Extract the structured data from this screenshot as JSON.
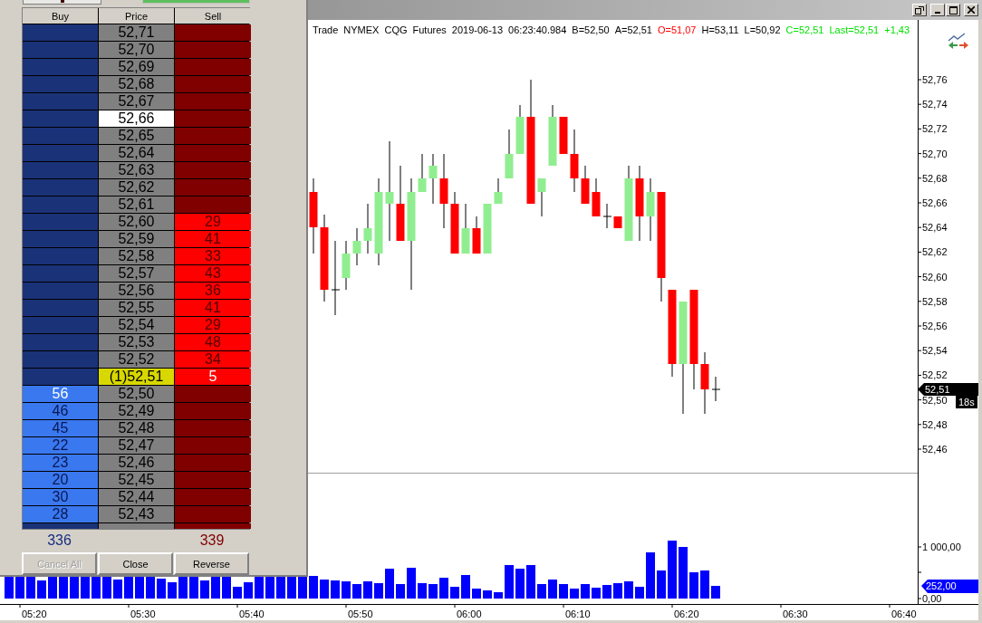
{
  "dom_panel": {
    "columns": [
      "Buy",
      "Price",
      "Sell"
    ],
    "rows": [
      {
        "kind": "level",
        "price": "52,71",
        "last_trade": false,
        "has_position": false
      },
      {
        "kind": "level",
        "price": "52,70",
        "last_trade": false,
        "has_position": false
      },
      {
        "kind": "level",
        "price": "52,69",
        "last_trade": false,
        "has_position": false
      },
      {
        "kind": "level",
        "price": "52,68",
        "last_trade": false,
        "has_position": false
      },
      {
        "kind": "level",
        "price": "52,67",
        "last_trade": false,
        "has_position": false
      },
      {
        "kind": "level",
        "price": "52,66",
        "last_trade": true,
        "has_position": false
      },
      {
        "kind": "level",
        "price": "52,65",
        "last_trade": false,
        "has_position": false
      },
      {
        "kind": "level",
        "price": "52,64",
        "last_trade": false,
        "has_position": false
      },
      {
        "kind": "level",
        "price": "52,63",
        "last_trade": false,
        "has_position": false
      },
      {
        "kind": "level",
        "price": "52,62",
        "last_trade": false,
        "has_position": false
      },
      {
        "kind": "level",
        "price": "52,61",
        "last_trade": false,
        "has_position": false
      },
      {
        "kind": "level",
        "price": "52,60",
        "last_trade": false,
        "has_position": false,
        "sell": "29"
      },
      {
        "kind": "level",
        "price": "52,59",
        "last_trade": false,
        "has_position": false,
        "sell": "41"
      },
      {
        "kind": "level",
        "price": "52,58",
        "last_trade": false,
        "has_position": false,
        "sell": "33"
      },
      {
        "kind": "level",
        "price": "52,57",
        "last_trade": false,
        "has_position": false,
        "sell": "43"
      },
      {
        "kind": "level",
        "price": "52,56",
        "last_trade": false,
        "has_position": false,
        "sell": "36"
      },
      {
        "kind": "level",
        "price": "52,55",
        "last_trade": false,
        "has_position": false,
        "sell": "41"
      },
      {
        "kind": "level",
        "price": "52,54",
        "last_trade": false,
        "has_position": false,
        "sell": "29"
      },
      {
        "kind": "level",
        "price": "52,53",
        "last_trade": false,
        "has_position": false,
        "sell": "48"
      },
      {
        "kind": "level",
        "price": "52,52",
        "last_trade": false,
        "has_position": false,
        "sell": "34"
      },
      {
        "kind": "best",
        "price": "(1)52,51",
        "last_trade": false,
        "has_position": true,
        "sell": "5"
      },
      {
        "kind": "best",
        "price": "52,50",
        "last_trade": false,
        "has_position": false,
        "buy": "56"
      },
      {
        "kind": "level",
        "price": "52,49",
        "last_trade": false,
        "has_position": false,
        "buy": "46"
      },
      {
        "kind": "level",
        "price": "52,48",
        "last_trade": false,
        "has_position": false,
        "buy": "45"
      },
      {
        "kind": "level",
        "price": "52,47",
        "last_trade": false,
        "has_position": false,
        "buy": "22"
      },
      {
        "kind": "level",
        "price": "52,46",
        "last_trade": false,
        "has_position": false,
        "buy": "23"
      },
      {
        "kind": "level",
        "price": "52,45",
        "last_trade": false,
        "has_position": false,
        "buy": "20"
      },
      {
        "kind": "level",
        "price": "52,44",
        "last_trade": false,
        "has_position": false,
        "buy": "30"
      },
      {
        "kind": "level",
        "price": "52,43",
        "last_trade": false,
        "has_position": false,
        "buy": "28"
      }
    ],
    "totals": {
      "buy": "336",
      "sell": "339"
    },
    "buttons": [
      {
        "label": "Cancel All",
        "disabled": true
      },
      {
        "label": "Close",
        "disabled": false
      },
      {
        "label": "Reverse",
        "disabled": false
      }
    ]
  },
  "chart": {
    "header": [
      {
        "text": "Trade"
      },
      {
        "text": "NYMEX"
      },
      {
        "text": "CQG"
      },
      {
        "text": "Futures"
      },
      {
        "text": "2019-06-13"
      },
      {
        "text": "06:23:40.984"
      },
      {
        "text": "B=52,50"
      },
      {
        "text": "A=52,51"
      },
      {
        "text": "O=51,07",
        "color": "#ff0000"
      },
      {
        "text": "H=53,11"
      },
      {
        "text": "L=50,92"
      },
      {
        "text": "C=52,51",
        "color": "#00e000"
      },
      {
        "text": "Last=52,51",
        "color": "#00e000"
      },
      {
        "text": "+1,43",
        "color": "#00e000"
      }
    ],
    "price_axis": [
      "52,76",
      "52,74",
      "52,72",
      "52,70",
      "52,68",
      "52,66",
      "52,64",
      "52,62",
      "52,60",
      "52,58",
      "52,56",
      "52,54",
      "52,52",
      "52,50",
      "52,48",
      "52,46"
    ],
    "last_price_tag": "52,51",
    "bar_timer": "18s",
    "volume_axis": [
      "1 000,00",
      "0,00"
    ],
    "volume_tag": "252,00",
    "time_axis": [
      "05:20",
      "05:30",
      "05:40",
      "05:50",
      "06:00",
      "06:10",
      "06:20",
      "06:30",
      "06:40"
    ]
  }
}
